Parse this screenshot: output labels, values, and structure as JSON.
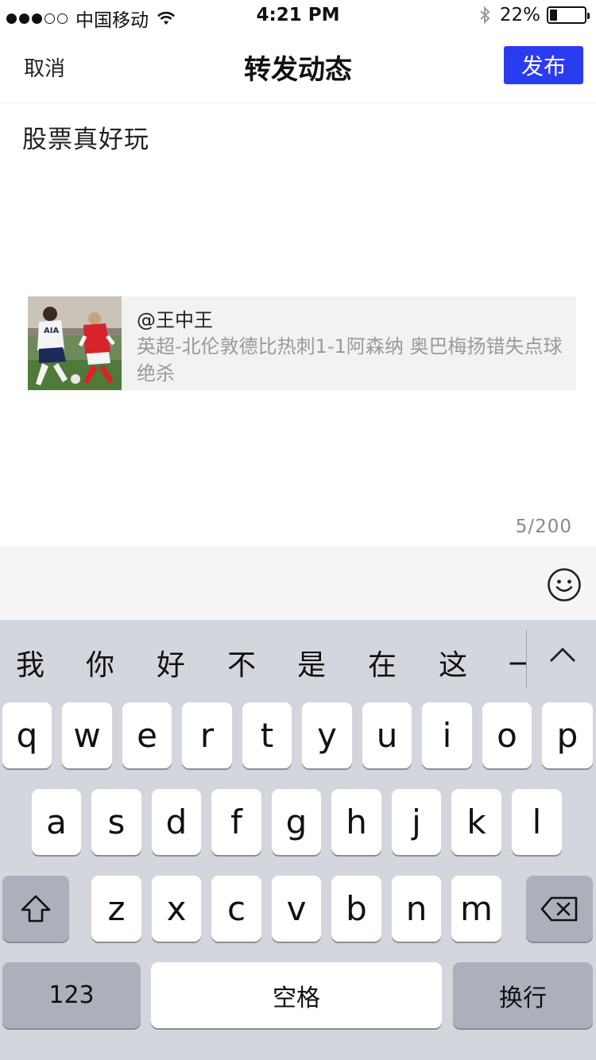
{
  "status_bar": {
    "carrier": "中国移动",
    "time": "4:21 PM",
    "battery_percent": "22%",
    "battery_level": 0.22,
    "signal_strength": 3
  },
  "nav": {
    "cancel_label": "取消",
    "title": "转发动态",
    "publish_label": "发布",
    "publish_color": "#2a3cf0"
  },
  "compose": {
    "text": "股票真好玩",
    "char_count": "5/200"
  },
  "repost": {
    "author": "@王中王",
    "summary": "英超-北伦敦德比热刺1-1阿森纳 奥巴梅扬错失点球绝杀"
  },
  "keyboard": {
    "candidates": [
      "我",
      "你",
      "好",
      "不",
      "是",
      "在",
      "这",
      "一"
    ],
    "row1": [
      "q",
      "w",
      "e",
      "r",
      "t",
      "y",
      "u",
      "i",
      "o",
      "p"
    ],
    "row2": [
      "a",
      "s",
      "d",
      "f",
      "g",
      "h",
      "j",
      "k",
      "l"
    ],
    "row3": [
      "z",
      "x",
      "c",
      "v",
      "b",
      "n",
      "m"
    ],
    "numbers_label": "123",
    "space_label": "空格",
    "return_label": "换行"
  }
}
